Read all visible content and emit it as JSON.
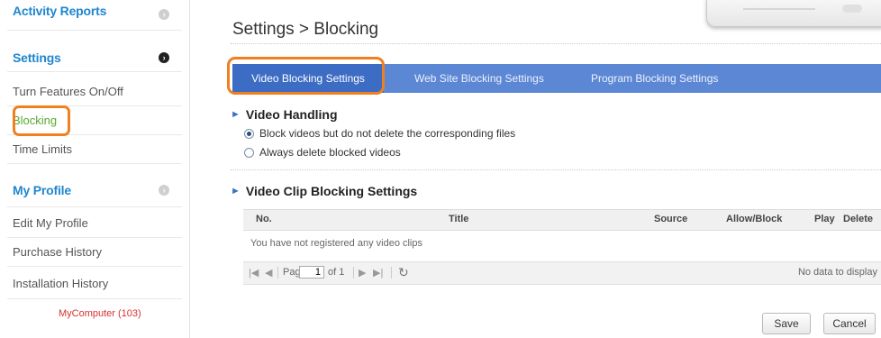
{
  "sidebar": {
    "activity_reports": "Activity Reports",
    "settings": "Settings",
    "settings_items": [
      "Turn Features On/Off",
      "Blocking",
      "Time Limits"
    ],
    "my_profile": "My Profile",
    "profile_items": [
      "Edit My Profile",
      "Purchase History",
      "Installation History"
    ],
    "computer": "MyComputer (103)"
  },
  "main": {
    "title": "Settings > Blocking",
    "tabs": [
      "Video Blocking Settings",
      "Web Site Blocking Settings",
      "Program Blocking Settings"
    ],
    "video_handling": {
      "heading": "Video Handling",
      "options": [
        "Block videos but do not delete the corresponding files",
        "Always delete blocked videos"
      ]
    },
    "clip_settings": {
      "heading": "Video Clip Blocking Settings",
      "columns": [
        "No.",
        "Title",
        "Source",
        "Allow/Block",
        "Play",
        "Delete"
      ],
      "empty": "You have not registered any video clips",
      "pager": {
        "page_label": "Page",
        "page_value": "1",
        "of_label": "of 1",
        "status": "No data to display"
      }
    },
    "save": "Save",
    "cancel": "Cancel"
  },
  "colors": {
    "accent": "#1f86d0",
    "tab_bar": "#5b87d5",
    "tab_active": "#3d6cc4",
    "highlight": "#f07f22",
    "selected_link": "#5aa832",
    "computer_link": "#d93030"
  }
}
